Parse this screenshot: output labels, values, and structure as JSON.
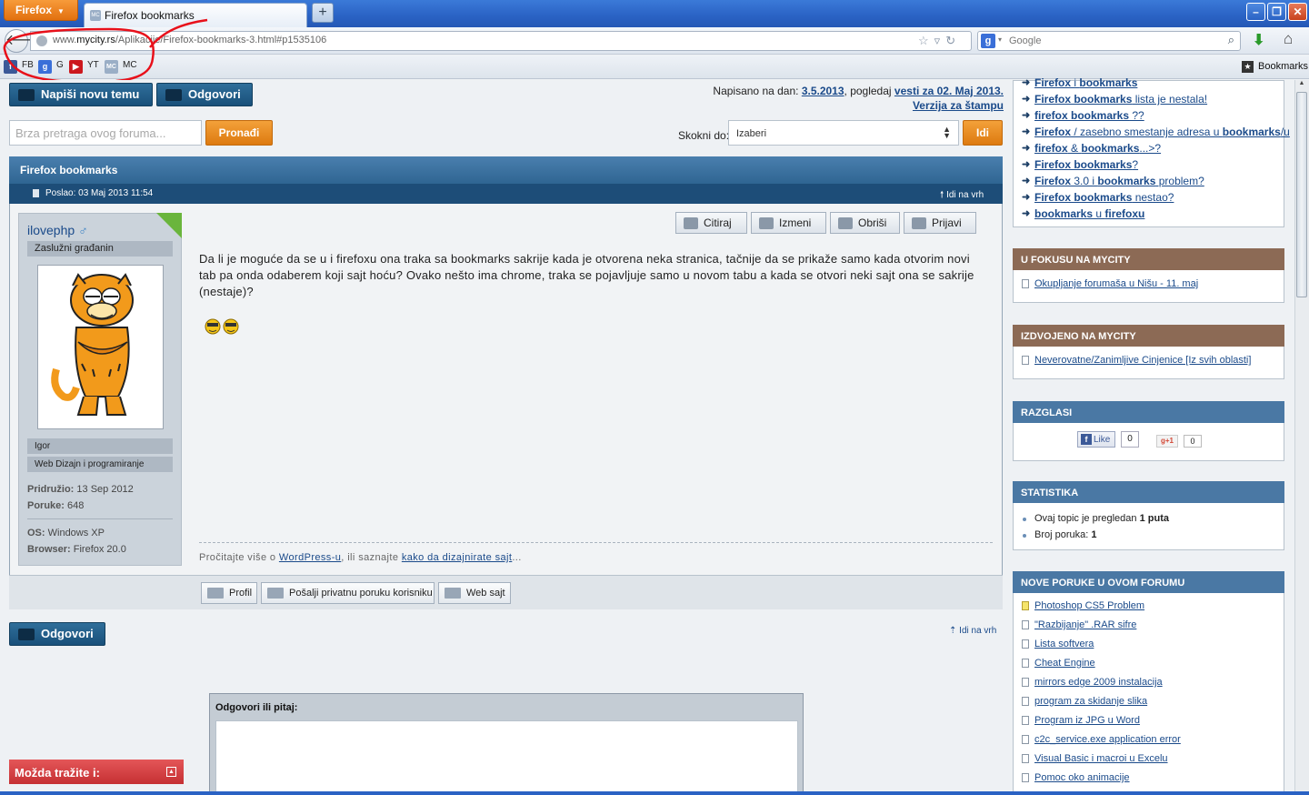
{
  "browser": {
    "app_button": "Firefox",
    "tab_title": "Firefox bookmarks",
    "url_prefix": "www.",
    "url_domain": "mycity.rs",
    "url_rest": "/Aplikacije/Firefox-bookmarks-3.html#p1535106",
    "search_engine": "Google",
    "bookmarks": [
      {
        "label": "FB",
        "icon": "facebook-icon",
        "color": "#3b5998"
      },
      {
        "label": "G",
        "icon": "google-icon",
        "color": "#3a6fd8"
      },
      {
        "label": "YT",
        "icon": "youtube-icon",
        "color": "#cc181e"
      },
      {
        "label": "MC",
        "icon": "mycity-icon",
        "color": "#9aaec6"
      }
    ],
    "bookmarks_menu": "Bookmarks"
  },
  "toolbar": {
    "new_topic": "Napiši novu temu",
    "reply": "Odgovori",
    "search_placeholder": "Brza pretraga ovog foruma...",
    "search_button": "Pronađi",
    "jump_label": "Skokni do:",
    "jump_value": "Izaberi",
    "jump_button": "Idi"
  },
  "posted_info": {
    "prefix": "Napisano na dan: ",
    "date": "3.5.2013",
    "middle": ", pogledaj ",
    "news": "vesti za 02. Maj 2013.",
    "print": "Verzija za štampu"
  },
  "post": {
    "title": "Firefox bookmarks",
    "posted": "Poslao: 03 Maj 2013 11:54",
    "to_top": "Idi na vrh",
    "actions": [
      "Citiraj",
      "Izmeni",
      "Obriši",
      "Prijavi"
    ],
    "text": "Da li je moguće da se u i firefoxu ona traka sa bookmarks sakrije kada je otvorena neka stranica, tačnije da se prikaže samo kada otvorim novi tab pa onda odaberem koji sajt hoću? Ovako nešto ima chrome, traka se pojavljuje samo u novom tabu a kada se otvori neki sajt ona se sakrije (nestaje)?",
    "footnote_pre": "Pročitajte više o ",
    "footnote_link1": "WordPress-u",
    "footnote_mid": ", ili saznajte ",
    "footnote_link2": "kako da dizajnirate sajt",
    "footnote_post": "...",
    "profile_buttons": [
      "Profil",
      "Pošalji privatnu poruku korisniku",
      "Web sajt"
    ]
  },
  "user": {
    "name": "ilovephp",
    "sex_symbol": "♂",
    "rank": "Zaslužni građanin",
    "real_name": "Igor",
    "occupation": "Web Dizajn i programiranje",
    "joined_label": "Pridružio:",
    "joined": "13 Sep 2012",
    "posts_label": "Poruke:",
    "posts": "648",
    "os_label": "OS:",
    "os": "Windows XP",
    "browser_label": "Browser:",
    "browser": "Firefox 20.0"
  },
  "bottom": {
    "reply": "Odgovori",
    "to_top": "Idi na vrh",
    "reply_label": "Odgovori ili pitaj:",
    "maybe": "Možda tražite i:"
  },
  "sidebar": {
    "related": [
      {
        "b": "Firefox",
        "t": " i ",
        "b2": "bookmarks",
        "t2": ""
      },
      {
        "b": "Firefox bookmarks",
        "t": " lista je nestala!",
        "b2": "",
        "t2": ""
      },
      {
        "b": "firefox bookmarks",
        "t": " ??",
        "b2": "",
        "t2": ""
      },
      {
        "b": "Firefox",
        "t": " / zasebno smestanje adresa u ",
        "b2": "bookmarks",
        "t2": "/u"
      },
      {
        "b": "firefox",
        "t": " & ",
        "b2": "bookmarks",
        "t2": "...>?"
      },
      {
        "b": "Firefox bookmarks",
        "t": "?",
        "b2": "",
        "t2": ""
      },
      {
        "b": "Firefox",
        "t": " 3.0 i ",
        "b2": "bookmarks",
        "t2": " problem?"
      },
      {
        "b": "Firefox bookmarks",
        "t": " nestao?",
        "b2": "",
        "t2": ""
      },
      {
        "b": "bookmarks",
        "t": " u ",
        "b2": "firefoxu",
        "t2": ""
      }
    ],
    "focus_title": "U FOKUSU NA MYCITY",
    "focus_link": "Okupljanje forumaša u Nišu - 11. maj",
    "featured_title": "IZDVOJENO NA MYCITY",
    "featured_link": "Neverovatne/Zanimljive Cinjenice [Iz svih oblasti]",
    "ads_title": "RAZGLASI",
    "fb_like": "Like",
    "fb_count": "0",
    "gplus": "+1",
    "gplus_count": "0",
    "stats_title": "STATISTIKA",
    "stat1_pre": "Ovaj topic je pregledan ",
    "stat1_val": "1 puta",
    "stat2_pre": "Broj poruka: ",
    "stat2_val": "1",
    "newposts_title": "NOVE PORUKE U OVOM FORUMU",
    "newposts": [
      "Photoshop CS5 Problem",
      "\"Razbijanje\" .RAR sifre",
      "Lista softvera",
      "Cheat Engine",
      "mirrors edge 2009 instalacija",
      "program za skidanje slika",
      "Program iz JPG u Word",
      "c2c_service.exe application error",
      "Visual Basic i macroi u Excelu",
      "Pomoc oko animacije"
    ]
  }
}
